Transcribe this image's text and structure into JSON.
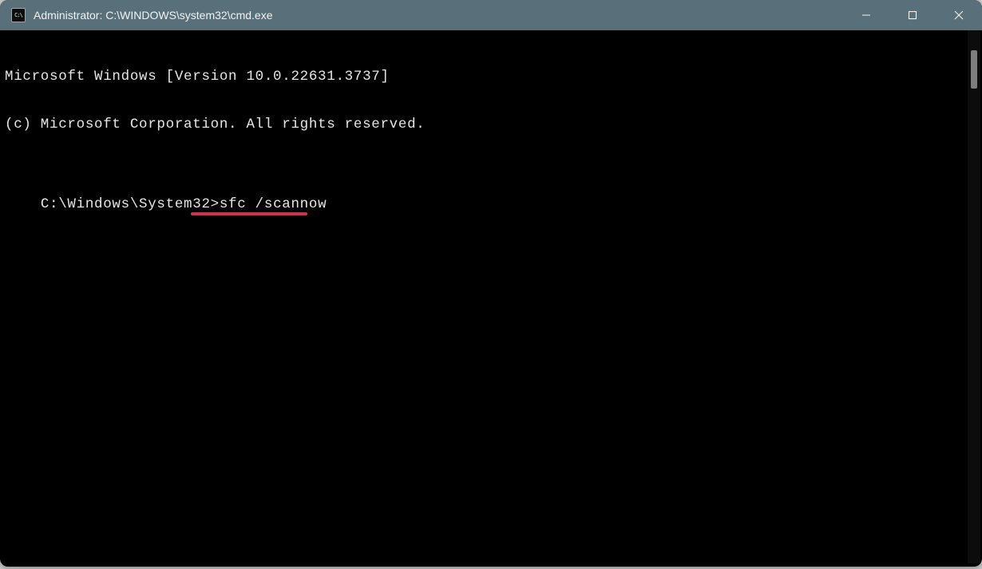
{
  "window": {
    "title": "Administrator: C:\\WINDOWS\\system32\\cmd.exe"
  },
  "terminal": {
    "line1": "Microsoft Windows [Version 10.0.22631.3737]",
    "line2": "(c) Microsoft Corporation. All rights reserved.",
    "blank": "",
    "prompt": "C:\\Windows\\System32>",
    "command": "sfc /scannow"
  },
  "annotation": {
    "underline_color": "#d7314a"
  }
}
